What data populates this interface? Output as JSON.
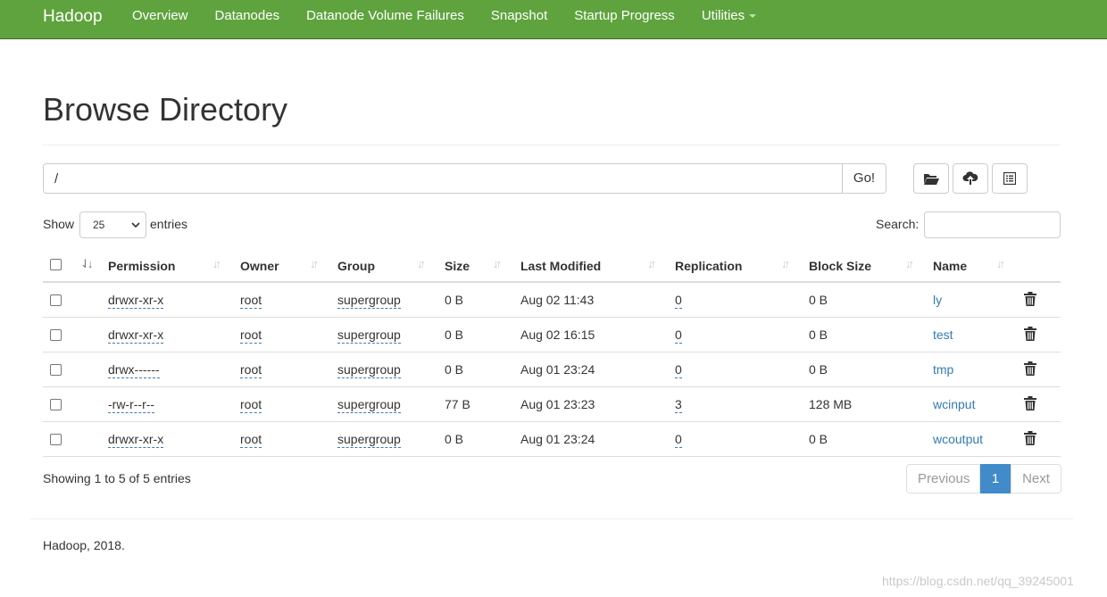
{
  "navbar": {
    "brand": "Hadoop",
    "items": [
      "Overview",
      "Datanodes",
      "Datanode Volume Failures",
      "Snapshot",
      "Startup Progress",
      "Utilities"
    ]
  },
  "page": {
    "title": "Browse Directory"
  },
  "path": {
    "value": "/",
    "go_label": "Go!"
  },
  "controls": {
    "show_label": "Show",
    "entries_value": "25",
    "entries_label": "entries",
    "search_label": "Search:"
  },
  "table": {
    "headers": [
      "Permission",
      "Owner",
      "Group",
      "Size",
      "Last Modified",
      "Replication",
      "Block Size",
      "Name"
    ],
    "rows": [
      {
        "permission": "drwxr-xr-x",
        "owner": "root",
        "group": "supergroup",
        "size": "0 B",
        "modified": "Aug 02 11:43",
        "replication": "0",
        "block_size": "0 B",
        "name": "ly"
      },
      {
        "permission": "drwxr-xr-x",
        "owner": "root",
        "group": "supergroup",
        "size": "0 B",
        "modified": "Aug 02 16:15",
        "replication": "0",
        "block_size": "0 B",
        "name": "test"
      },
      {
        "permission": "drwx------",
        "owner": "root",
        "group": "supergroup",
        "size": "0 B",
        "modified": "Aug 01 23:24",
        "replication": "0",
        "block_size": "0 B",
        "name": "tmp"
      },
      {
        "permission": "-rw-r--r--",
        "owner": "root",
        "group": "supergroup",
        "size": "77 B",
        "modified": "Aug 01 23:23",
        "replication": "3",
        "block_size": "128 MB",
        "name": "wcinput"
      },
      {
        "permission": "drwxr-xr-x",
        "owner": "root",
        "group": "supergroup",
        "size": "0 B",
        "modified": "Aug 01 23:24",
        "replication": "0",
        "block_size": "0 B",
        "name": "wcoutput"
      }
    ]
  },
  "summary": {
    "showing": "Showing 1 to 5 of 5 entries"
  },
  "pagination": {
    "previous": "Previous",
    "current": "1",
    "next": "Next"
  },
  "footer": {
    "text": "Hadoop, 2018.",
    "watermark": "https://blog.csdn.net/qq_39245001"
  },
  "colors": {
    "navbar": "#5fa33e",
    "link": "#337ab7",
    "active_page": "#428bca"
  }
}
